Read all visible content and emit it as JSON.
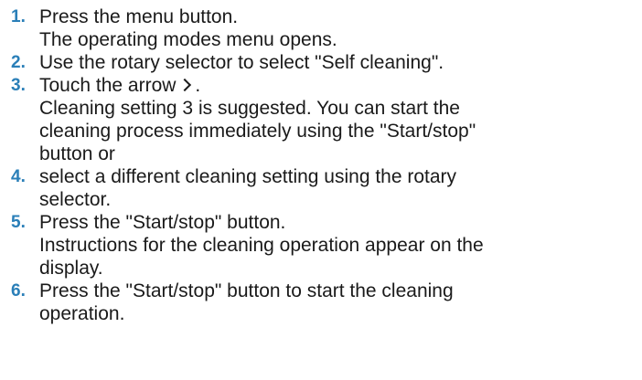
{
  "theme": {
    "number_color": "#2a7fb8",
    "text_color": "#1a1a1a"
  },
  "steps": [
    {
      "number": "1.",
      "lines": [
        "Press the menu button.",
        "The operating modes menu opens."
      ]
    },
    {
      "number": "2.",
      "lines": [
        "Use the rotary selector to select \"Self cleaning\"."
      ]
    },
    {
      "number": "3.",
      "lines_before_icon": "Touch the arrow",
      "icon": "chevron-right-icon",
      "lines_after_icon": ".",
      "lines": [
        "Cleaning setting 3 is suggested. You can start the",
        "cleaning process immediately using the \"Start/stop\"",
        "button or"
      ]
    },
    {
      "number": "4.",
      "lines": [
        "select a different cleaning setting using the rotary",
        "selector."
      ]
    },
    {
      "number": "5.",
      "lines": [
        "Press the \"Start/stop\" button.",
        "Instructions for the cleaning operation appear on the",
        "display."
      ]
    },
    {
      "number": "6.",
      "lines": [
        "Press the \"Start/stop\" button to start the cleaning",
        "operation."
      ]
    }
  ]
}
